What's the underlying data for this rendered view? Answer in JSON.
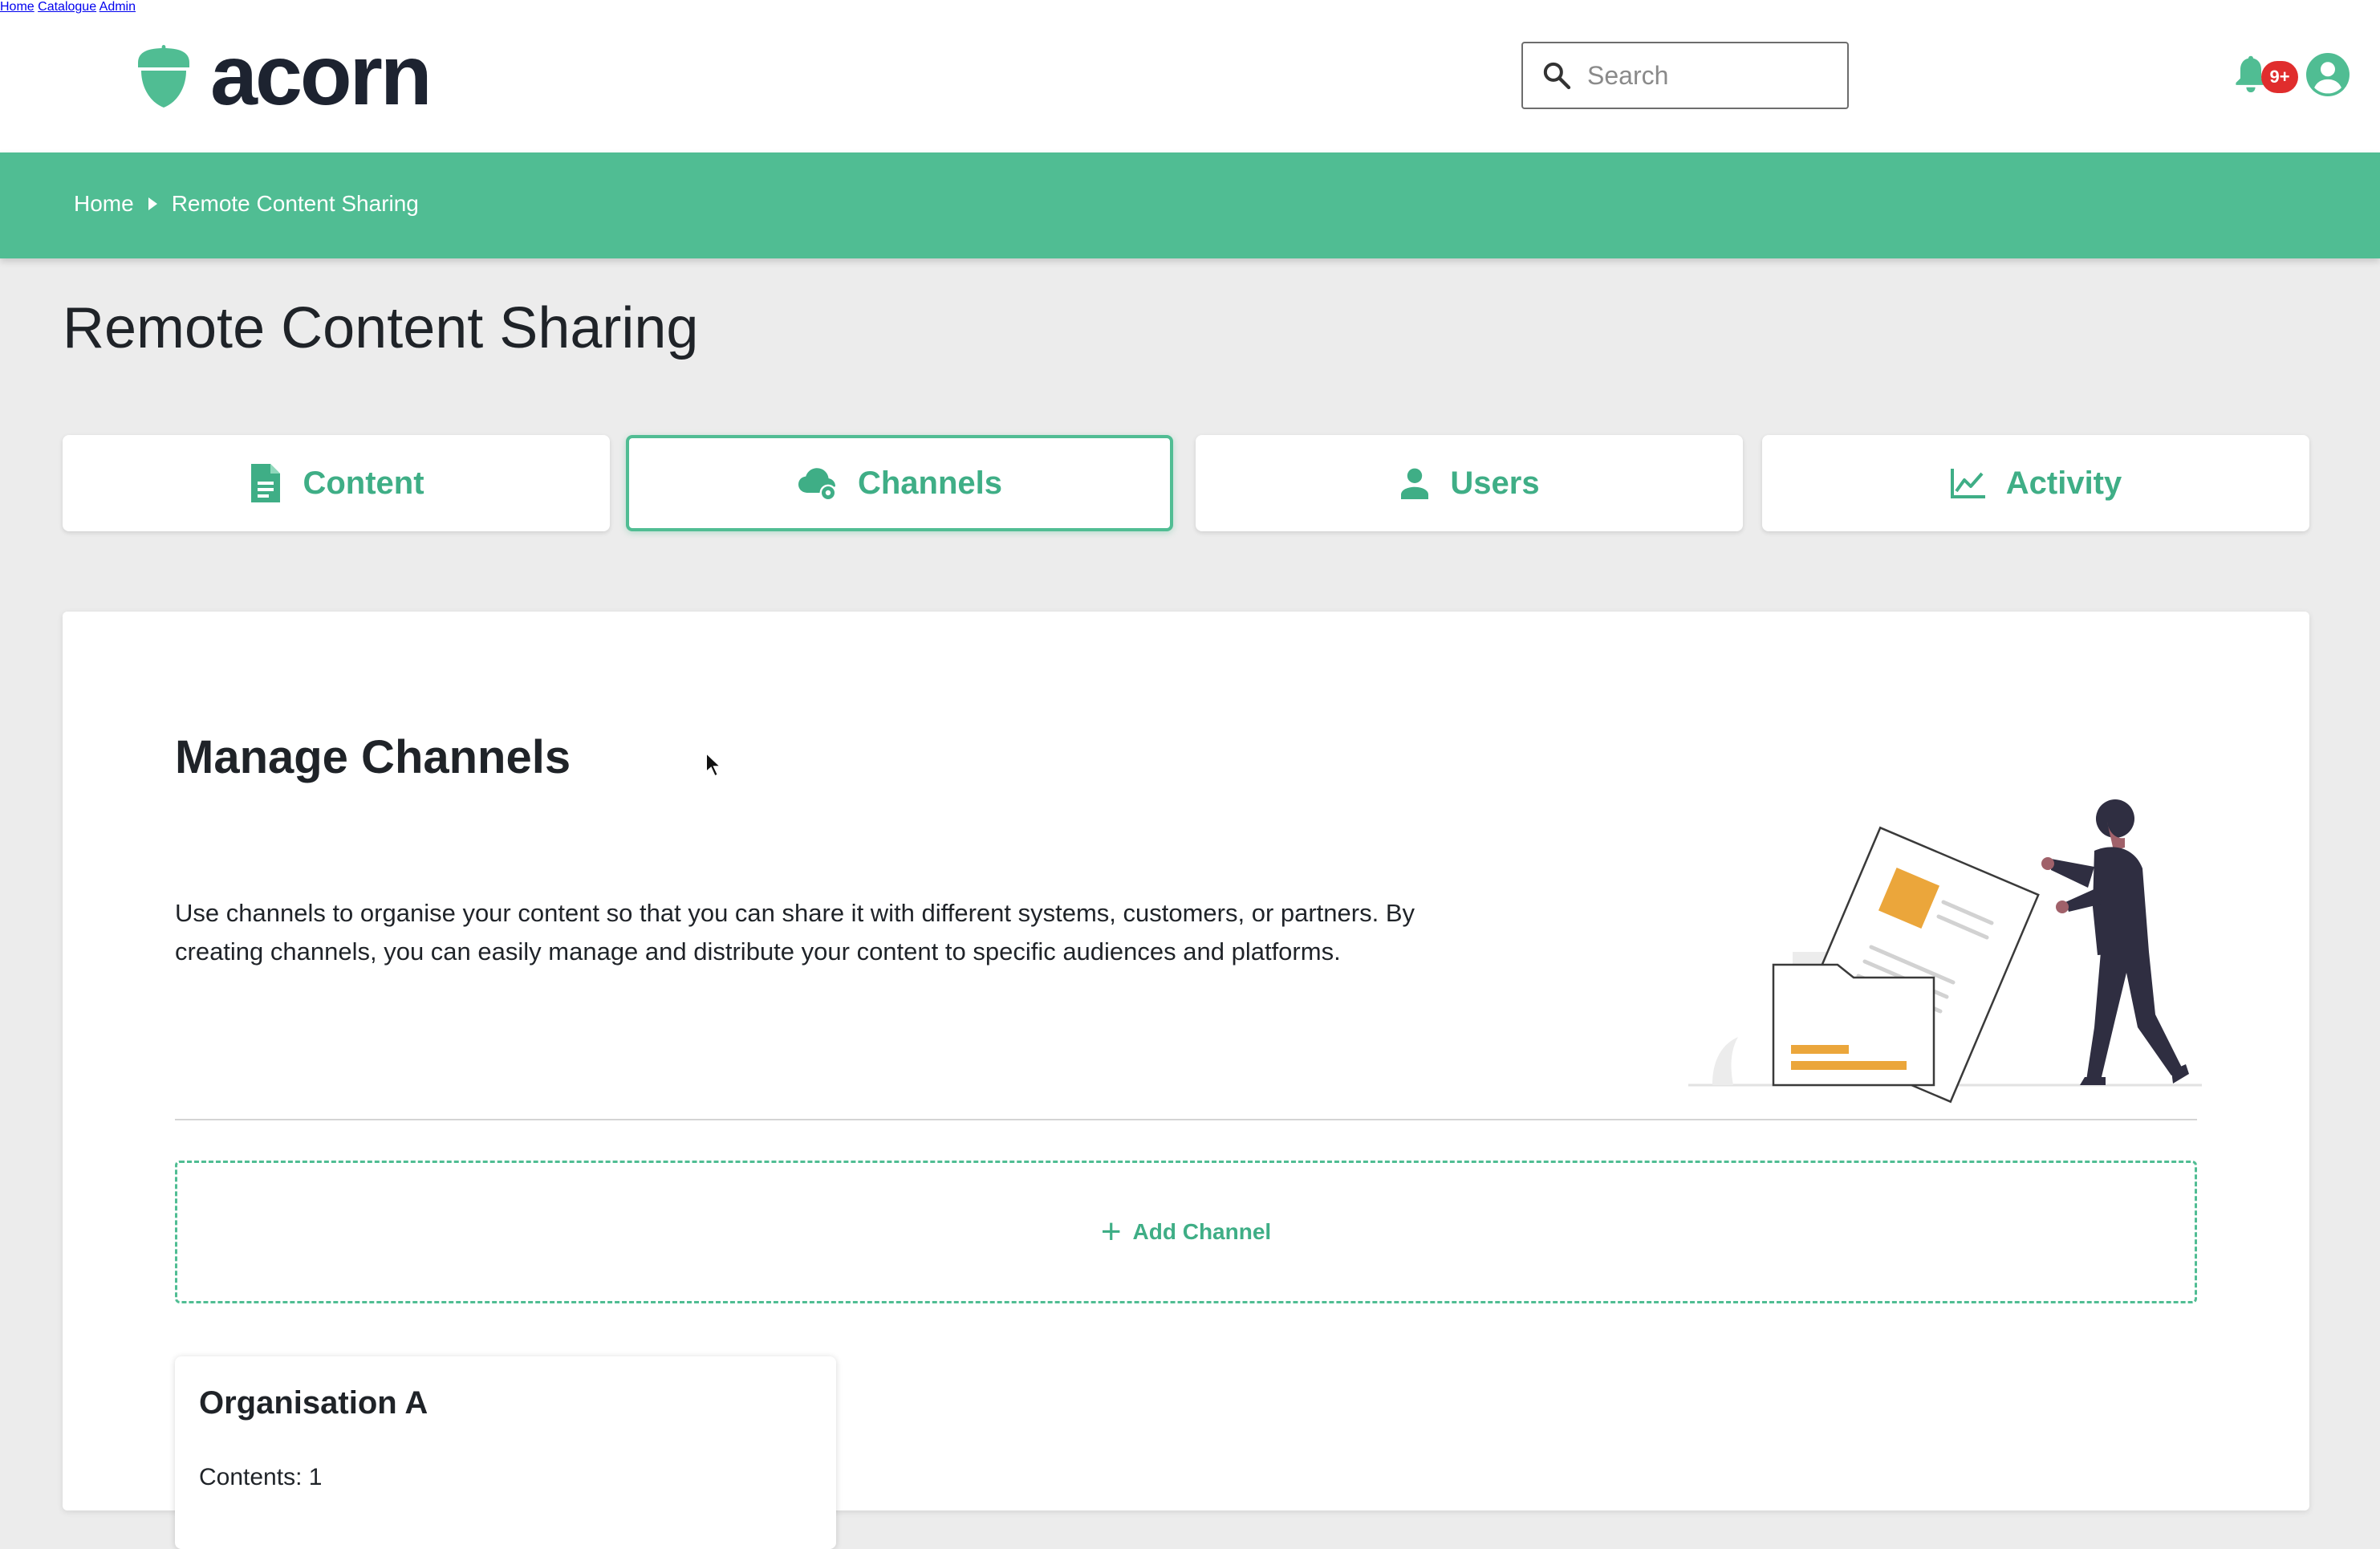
{
  "header": {
    "logo_text": "acorn",
    "search_placeholder": "Search",
    "nav": [
      "Home",
      "Catalogue",
      "Admin"
    ],
    "notification_badge": "9+"
  },
  "breadcrumb": [
    "Home",
    "Remote Content Sharing"
  ],
  "page_title": "Remote Content Sharing",
  "tabs": [
    {
      "label": "Content",
      "icon": "document-icon"
    },
    {
      "label": "Channels",
      "icon": "cloud-settings-icon",
      "active": true
    },
    {
      "label": "Users",
      "icon": "user-icon"
    },
    {
      "label": "Activity",
      "icon": "line-chart-icon"
    }
  ],
  "main": {
    "section_title": "Manage Channels",
    "description": "Use channels to organise your content so that you can share it with different systems, customers, or partners. By creating channels, you can easily manage and distribute your content to specific audiences and platforms.",
    "add_channel_label": "Add Channel",
    "channels": [
      {
        "name": "Organisation A",
        "contents": "Contents: 1"
      }
    ]
  },
  "colors": {
    "accent": "#50bd93",
    "accent_text": "#3fae86",
    "badge": "#e02d2d",
    "illustration_orange": "#eba63b",
    "illustration_dark": "#2f2e41"
  }
}
